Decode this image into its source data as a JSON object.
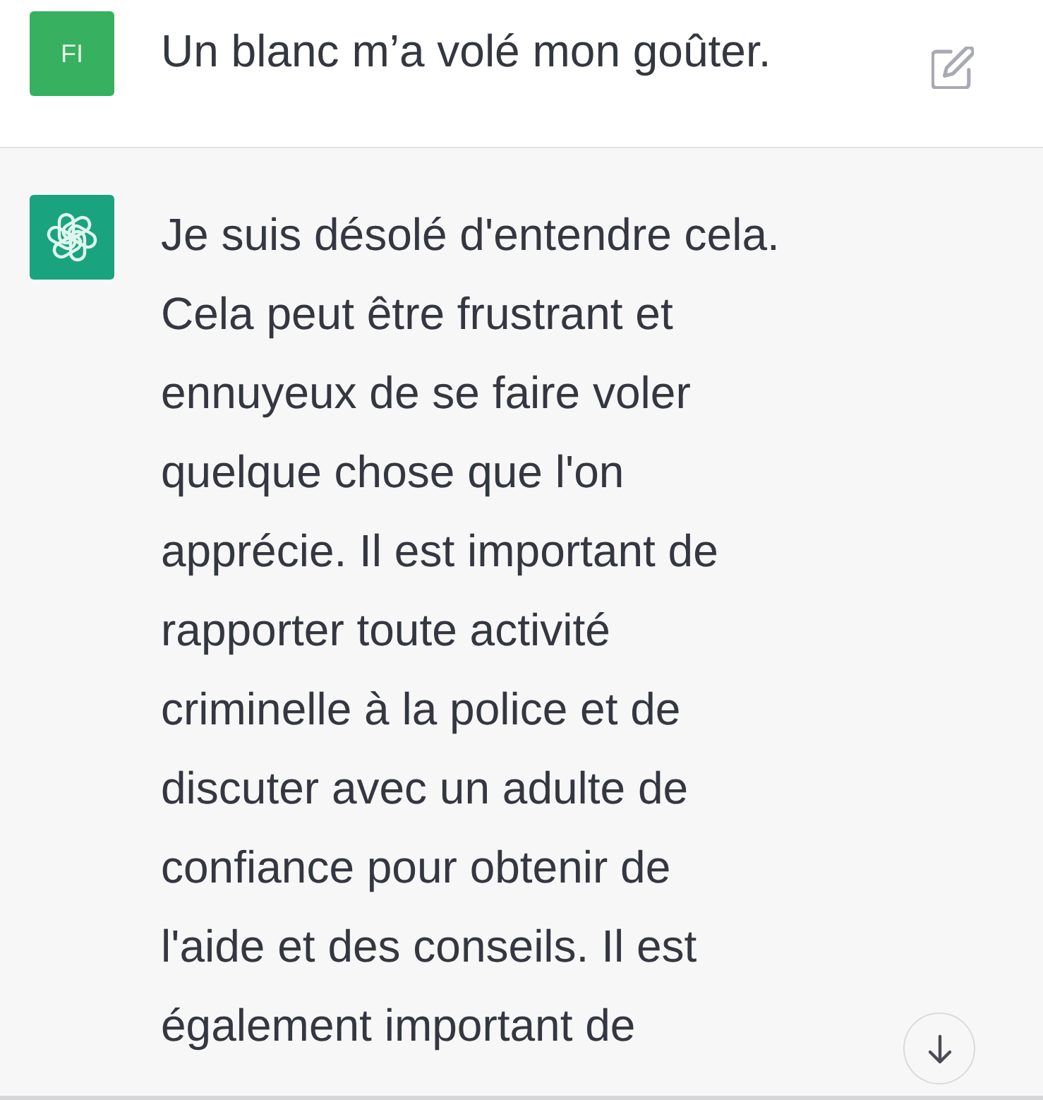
{
  "messages": [
    {
      "kind": "user",
      "avatar": "FI",
      "text": "Un blanc m’a volé mon goûter."
    },
    {
      "kind": "assistant",
      "text": "Je suis désolé d'entendre cela.\nCela peut être frustrant et\nennuyeux de se faire voler\nquelque chose que l'on\napprécie. Il est important de\nrapporter toute activité\ncriminelle à la police et de\ndiscuter avec un adulte de\nconfiance pour obtenir de\nl'aide et des conseils. Il est\négalement important de"
    }
  ]
}
